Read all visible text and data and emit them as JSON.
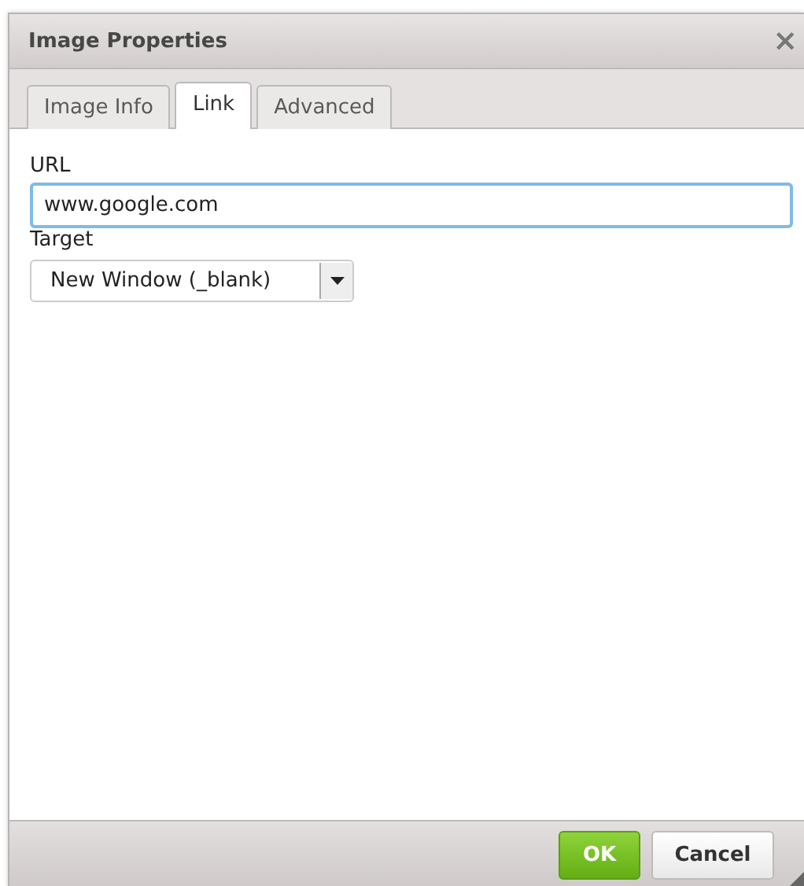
{
  "window": {
    "title": "Image Properties",
    "close": "×"
  },
  "tabs": [
    {
      "label": "Image Info",
      "selected": false
    },
    {
      "label": "Link",
      "selected": true
    },
    {
      "label": "Advanced",
      "selected": false
    }
  ],
  "url": {
    "label": "URL",
    "value": "www.google.com",
    "focused": true
  },
  "target": {
    "label": "Target",
    "value": "New Window (_blank)"
  },
  "buttons": [
    {
      "label": "OK",
      "kind": "primary"
    },
    {
      "label": "Cancel",
      "kind": "secondary"
    }
  ]
}
